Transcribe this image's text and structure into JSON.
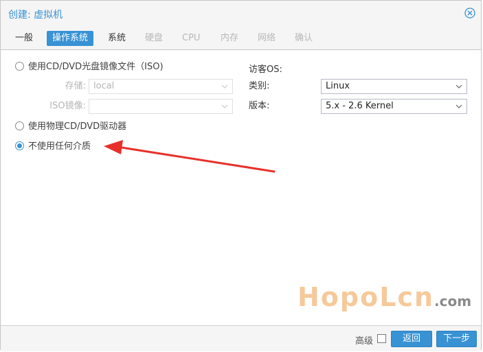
{
  "window": {
    "title": "创建: 虚拟机"
  },
  "tabs": [
    {
      "label": "一般",
      "state": "normal"
    },
    {
      "label": "操作系统",
      "state": "active"
    },
    {
      "label": "系统",
      "state": "normal"
    },
    {
      "label": "硬盘",
      "state": "disabled"
    },
    {
      "label": "CPU",
      "state": "disabled"
    },
    {
      "label": "内存",
      "state": "disabled"
    },
    {
      "label": "网络",
      "state": "disabled"
    },
    {
      "label": "确认",
      "state": "disabled"
    }
  ],
  "media": {
    "option_iso": "使用CD/DVD光盘镜像文件（ISO)",
    "storage_label": "存储:",
    "storage_value": "local",
    "iso_label": "ISO镜像:",
    "iso_value": "",
    "option_physical": "使用物理CD/DVD驱动器",
    "option_none": "不使用任何介质",
    "selected": "option_none"
  },
  "guest_os": {
    "section_title": "访客OS:",
    "type_label": "类别:",
    "type_value": "Linux",
    "version_label": "版本:",
    "version_value": "5.x - 2.6 Kernel"
  },
  "footer": {
    "advanced_label": "高级",
    "advanced_checked": false,
    "back_label": "返回",
    "next_label": "下一步"
  },
  "watermark": {
    "main": "HopoLcn",
    "suffix": ".com"
  },
  "colors": {
    "accent": "#3892d4",
    "arrow": "#e8302a",
    "watermark": "#f6c99a"
  }
}
